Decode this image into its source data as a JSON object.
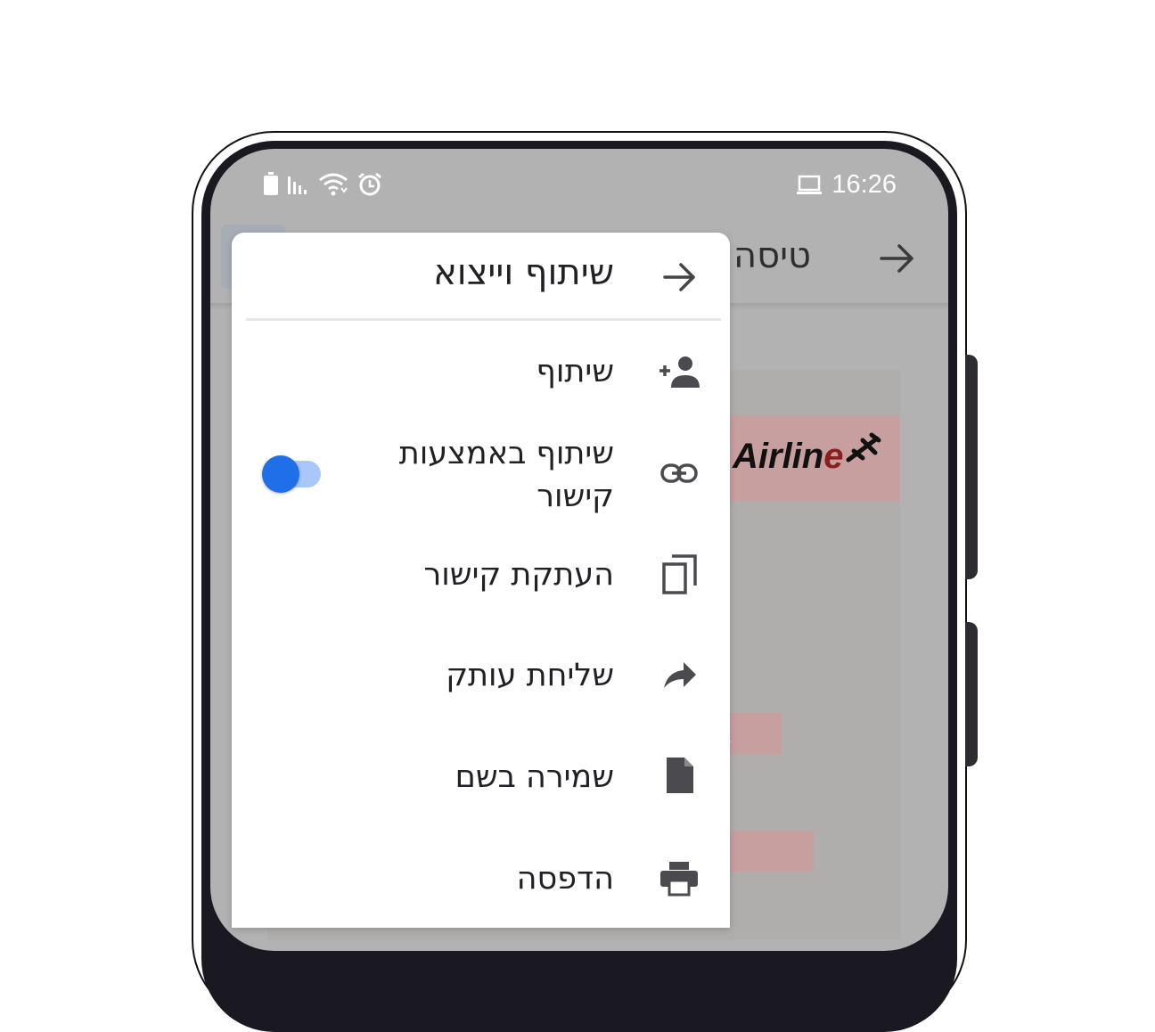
{
  "status_bar": {
    "time": "16:26",
    "left_icons": [
      "battery-icon",
      "signal-icon",
      "wifi-icon",
      "alarm-icon"
    ],
    "right_icons": [
      "laptop-icon"
    ]
  },
  "background_app": {
    "title_partial": "טיסה",
    "banner_text": "Airlin",
    "banner_text_accent": "e",
    "accent_color": "#8b1f1f"
  },
  "menu": {
    "title": "שיתוף וייצוא",
    "items": [
      {
        "label": "שיתוף",
        "icon": "person-add-icon"
      },
      {
        "label_line1": "שיתוף באמצעות",
        "label_line2": "קישור",
        "icon": "link-icon",
        "toggle_on": true
      },
      {
        "label": "העתקת קישור",
        "icon": "copy-icon"
      },
      {
        "label": "שליחת עותק",
        "icon": "share-arrow-icon"
      },
      {
        "label": "שמירה בשם",
        "icon": "file-icon"
      },
      {
        "label": "הדפסה",
        "icon": "print-icon"
      }
    ],
    "toggle_color": "#1f6fe8"
  }
}
